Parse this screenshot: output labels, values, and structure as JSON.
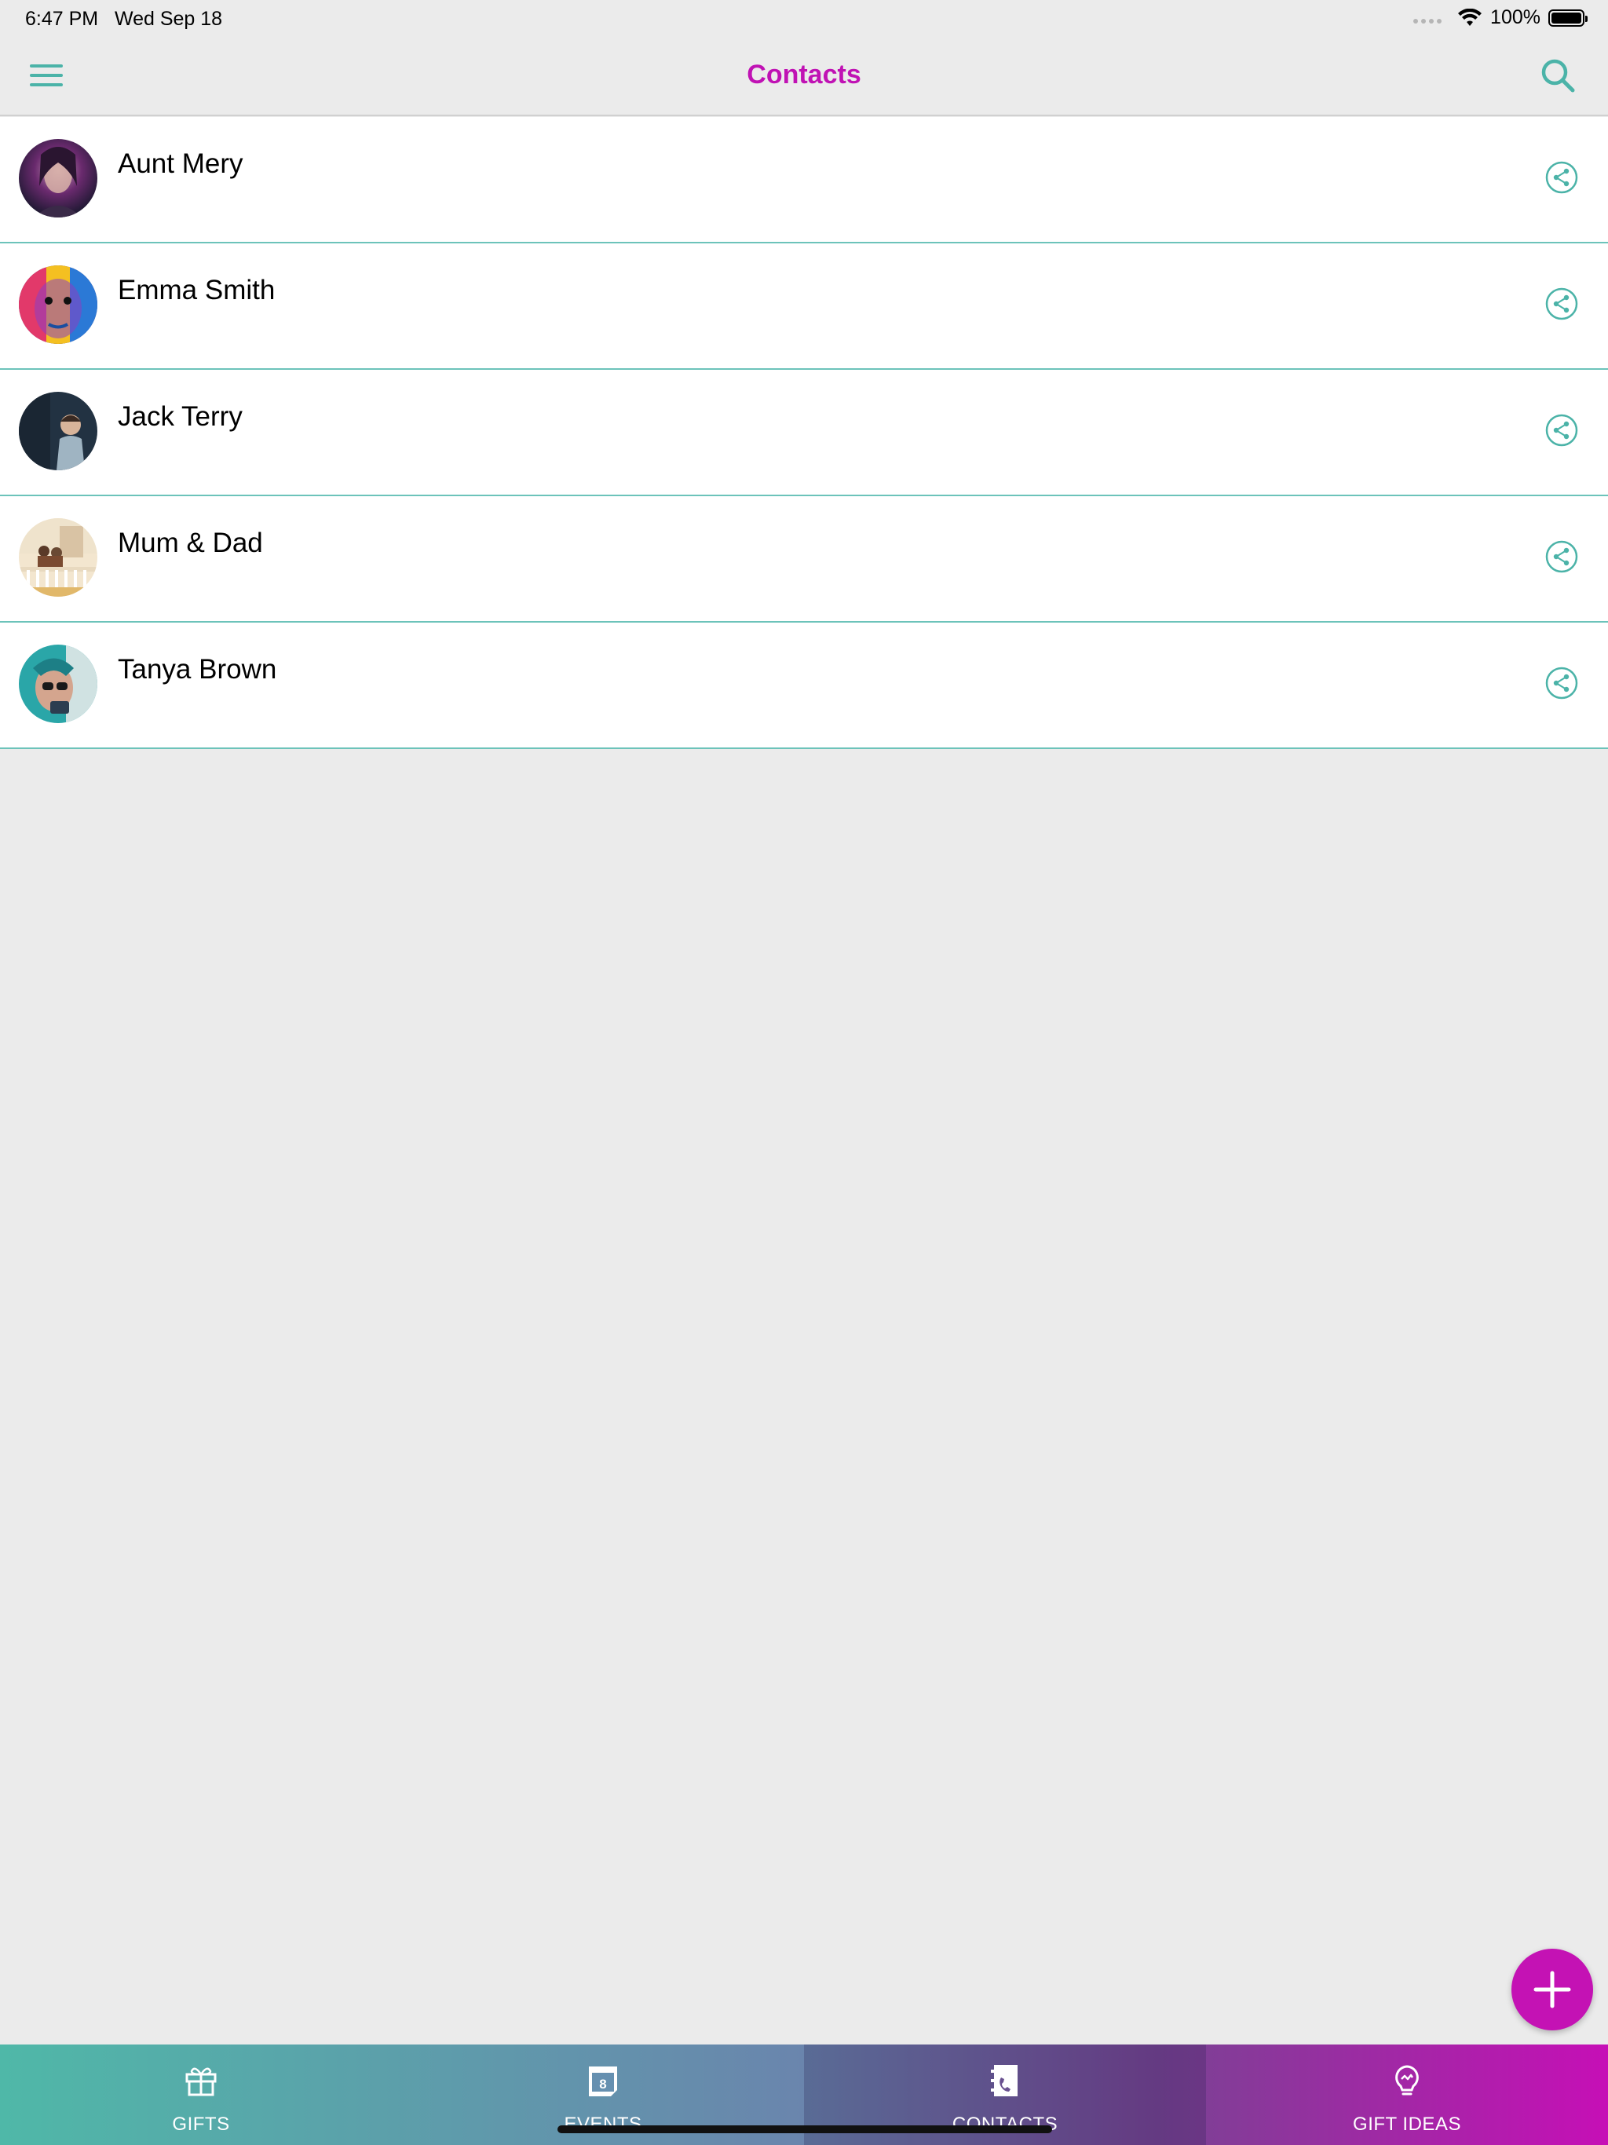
{
  "status_bar": {
    "time": "6:47 PM",
    "date": "Wed Sep 18",
    "battery": "100%",
    "wifi_icon": "wifi-icon",
    "battery_icon": "battery-full-icon"
  },
  "nav_bar": {
    "title": "Contacts",
    "menu_icon": "hamburger-menu-icon",
    "search_icon": "search-icon"
  },
  "contacts": [
    {
      "name": "Aunt Mery",
      "avatar": "avatar-photo",
      "share_icon": "share-icon"
    },
    {
      "name": "Emma Smith",
      "avatar": "avatar-photo",
      "share_icon": "share-icon"
    },
    {
      "name": "Jack Terry",
      "avatar": "avatar-photo",
      "share_icon": "share-icon"
    },
    {
      "name": "Mum & Dad",
      "avatar": "avatar-photo",
      "share_icon": "share-icon"
    },
    {
      "name": "Tanya Brown",
      "avatar": "avatar-photo",
      "share_icon": "share-icon"
    }
  ],
  "fab": {
    "icon": "plus-icon",
    "color": "#c412b4"
  },
  "tab_bar": {
    "tabs": [
      {
        "label": "GIFTS",
        "icon": "gift-icon"
      },
      {
        "label": "EVENTS",
        "icon": "calendar-icon"
      },
      {
        "label": "CONTACTS",
        "icon": "contacts-book-icon",
        "active": true
      },
      {
        "label": "GIFT IDEAS",
        "icon": "lightbulb-icon"
      }
    ]
  },
  "colors": {
    "accent": "#4bb3a8",
    "title": "#c012b4",
    "divider": "#6cc3ba",
    "background": "#ebebeb"
  }
}
